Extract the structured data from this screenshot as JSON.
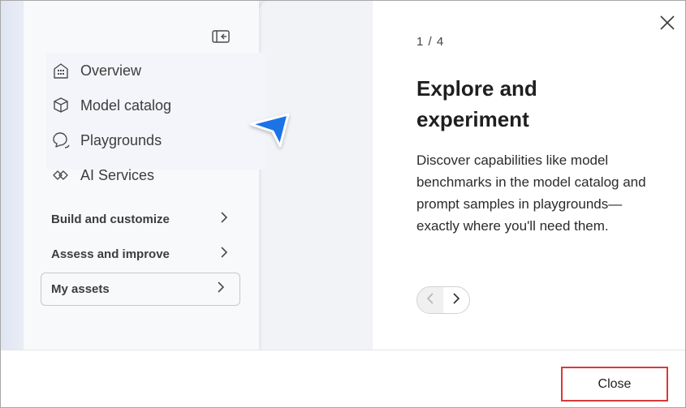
{
  "dialog": {
    "step": "1 / 4",
    "heading": "Explore and experiment",
    "body": "Discover capabilities like model benchmarks in the model catalog and prompt samples in playgrounds—exactly where you'll need them.",
    "close_label": "Close"
  },
  "illustration": {
    "nav_items": [
      {
        "label": "Overview",
        "icon": "building-icon"
      },
      {
        "label": "Model catalog",
        "icon": "cube-icon"
      },
      {
        "label": "Playgrounds",
        "icon": "chat-icon"
      },
      {
        "label": "AI Services",
        "icon": "link-icon"
      }
    ],
    "groups": [
      {
        "label": "Build and customize"
      },
      {
        "label": "Assess and improve"
      }
    ],
    "assets_label": "My assets",
    "pointer_color": "#1a73e8"
  },
  "colors": {
    "close_border": "#d93a3a",
    "illustration_bg": "#eef0f6"
  }
}
